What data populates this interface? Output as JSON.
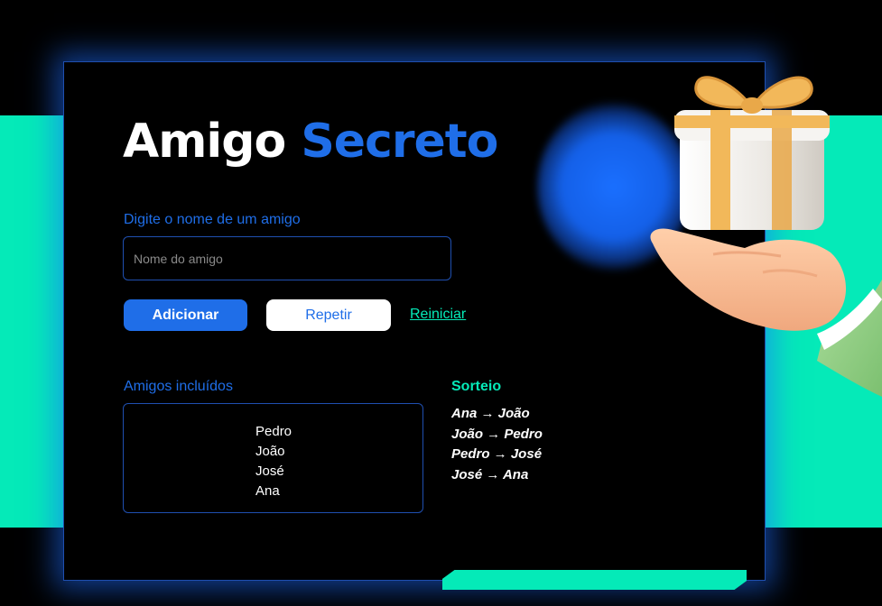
{
  "header": {
    "title_main": "Amigo",
    "title_accent": "Secreto"
  },
  "form": {
    "label": "Digite o nome de um amigo",
    "input_placeholder": "Nome do amigo",
    "input_value": "",
    "add_label": "Adicionar",
    "repeat_label": "Repetir",
    "reset_label": "Reiniciar"
  },
  "friends": {
    "title": "Amigos incluídos",
    "items": [
      "Pedro",
      "João",
      "José",
      "Ana"
    ]
  },
  "draw": {
    "title": "Sorteio",
    "results": [
      "Ana → João",
      "João → Pedro",
      "Pedro → José",
      "José → Ana"
    ]
  },
  "colors": {
    "accent": "#1f6ee8",
    "teal": "#05eab8",
    "background": "#000000"
  },
  "icons": {
    "illustration": "hand-holding-gift-icon"
  }
}
